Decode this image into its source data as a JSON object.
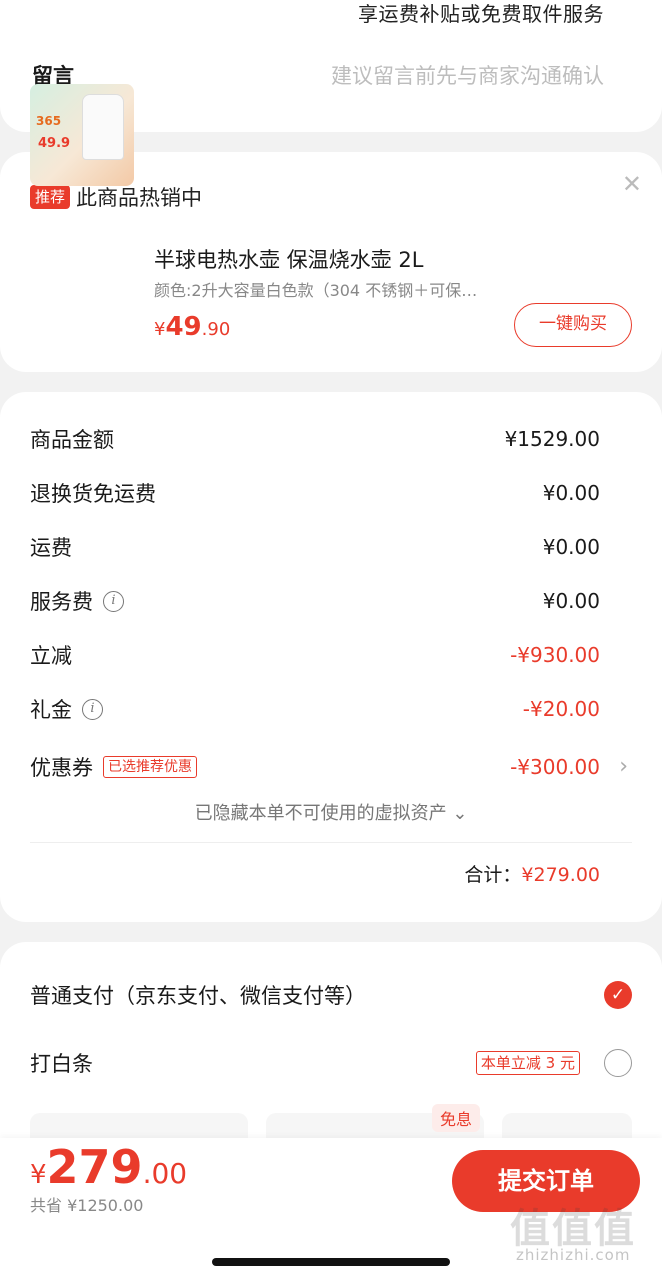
{
  "top": {
    "cut_text": "享运费补贴或免费取件服务",
    "message_label": "留言",
    "message_placeholder": "建议留言前先与商家沟通确认"
  },
  "recommend": {
    "tag": "推荐",
    "title": "此商品热销中",
    "close_icon": "close-icon",
    "product": {
      "name": "半球电热水壶 保温烧水壶 2L",
      "spec": "颜色:2升大容量白色款（304 不锈钢＋可保…",
      "price_symbol": "¥",
      "price_int": "49",
      "price_dec": ".90",
      "image_text_1": "365",
      "image_text_2": "49.9",
      "buy_label": "一键购买"
    }
  },
  "summary": {
    "rows": [
      {
        "label": "商品金额",
        "value": "¥1529.00"
      },
      {
        "label": "退换货免运费",
        "value": "¥0.00"
      },
      {
        "label": "运费",
        "value": "¥0.00"
      },
      {
        "label": "服务费",
        "value": "¥0.00",
        "info": "i"
      },
      {
        "label": "立减",
        "value": "-¥930.00"
      },
      {
        "label": "礼金",
        "value": "-¥20.00",
        "info": "i"
      },
      {
        "label": "优惠券",
        "value": "-¥300.00",
        "badge": "已选推荐优惠"
      }
    ],
    "hidden_note": "已隐藏本单不可使用的虚拟资产 ⌄",
    "total_label": "合计：",
    "total_value": "¥279.00"
  },
  "payment": {
    "option1": "普通支付（京东支付、微信支付等）",
    "option2": "打白条",
    "option2_promo": "本单立减 3 元",
    "installment_free": "免息"
  },
  "bottom": {
    "price_symbol": "¥",
    "price_int": "279",
    "price_dec": ".00",
    "save_text": "共省 ¥1250.00",
    "submit_label": "提交订单"
  },
  "watermark": {
    "text": "值值值",
    "url": "zhizhizhi.com"
  },
  "colors": {
    "accent": "#e93b2b",
    "bg": "#f2f2f2"
  }
}
